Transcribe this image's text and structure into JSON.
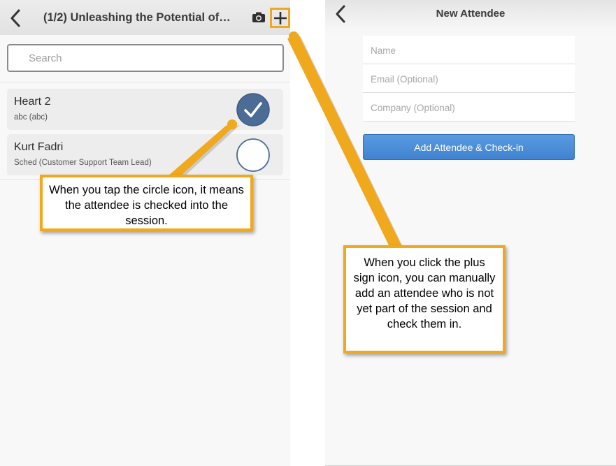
{
  "colors": {
    "callout_border": "#f0a81c",
    "checked_fill": "#4a6c95",
    "circle_outline": "#4a6c95",
    "primary_button": "#4a90d9"
  },
  "left_screen": {
    "header": {
      "back_icon": "chevron-left-icon",
      "title": "(1/2) Unleashing the Potential of…",
      "camera_icon": "camera-icon",
      "plus_icon": "plus-icon"
    },
    "search": {
      "placeholder": "Search"
    },
    "attendees": [
      {
        "name": "Heart 2",
        "subtitle": "abc (abc)",
        "checked": true
      },
      {
        "name": "Kurt Fadri",
        "subtitle": "Sched (Customer Support Team Lead)",
        "checked": false
      }
    ]
  },
  "right_screen": {
    "header": {
      "back_icon": "chevron-left-icon",
      "title": "New Attendee"
    },
    "fields": {
      "name_placeholder": "Name",
      "email_placeholder": "Email (Optional)",
      "company_placeholder": "Company (Optional)"
    },
    "submit_label": "Add Attendee & Check-in"
  },
  "callouts": {
    "circle_icon": "When you tap the circle icon, it means the attendee is checked into the session.",
    "plus_icon": "When you click the plus sign icon, you can manually add an attendee who is not yet part of the session and check them in."
  }
}
